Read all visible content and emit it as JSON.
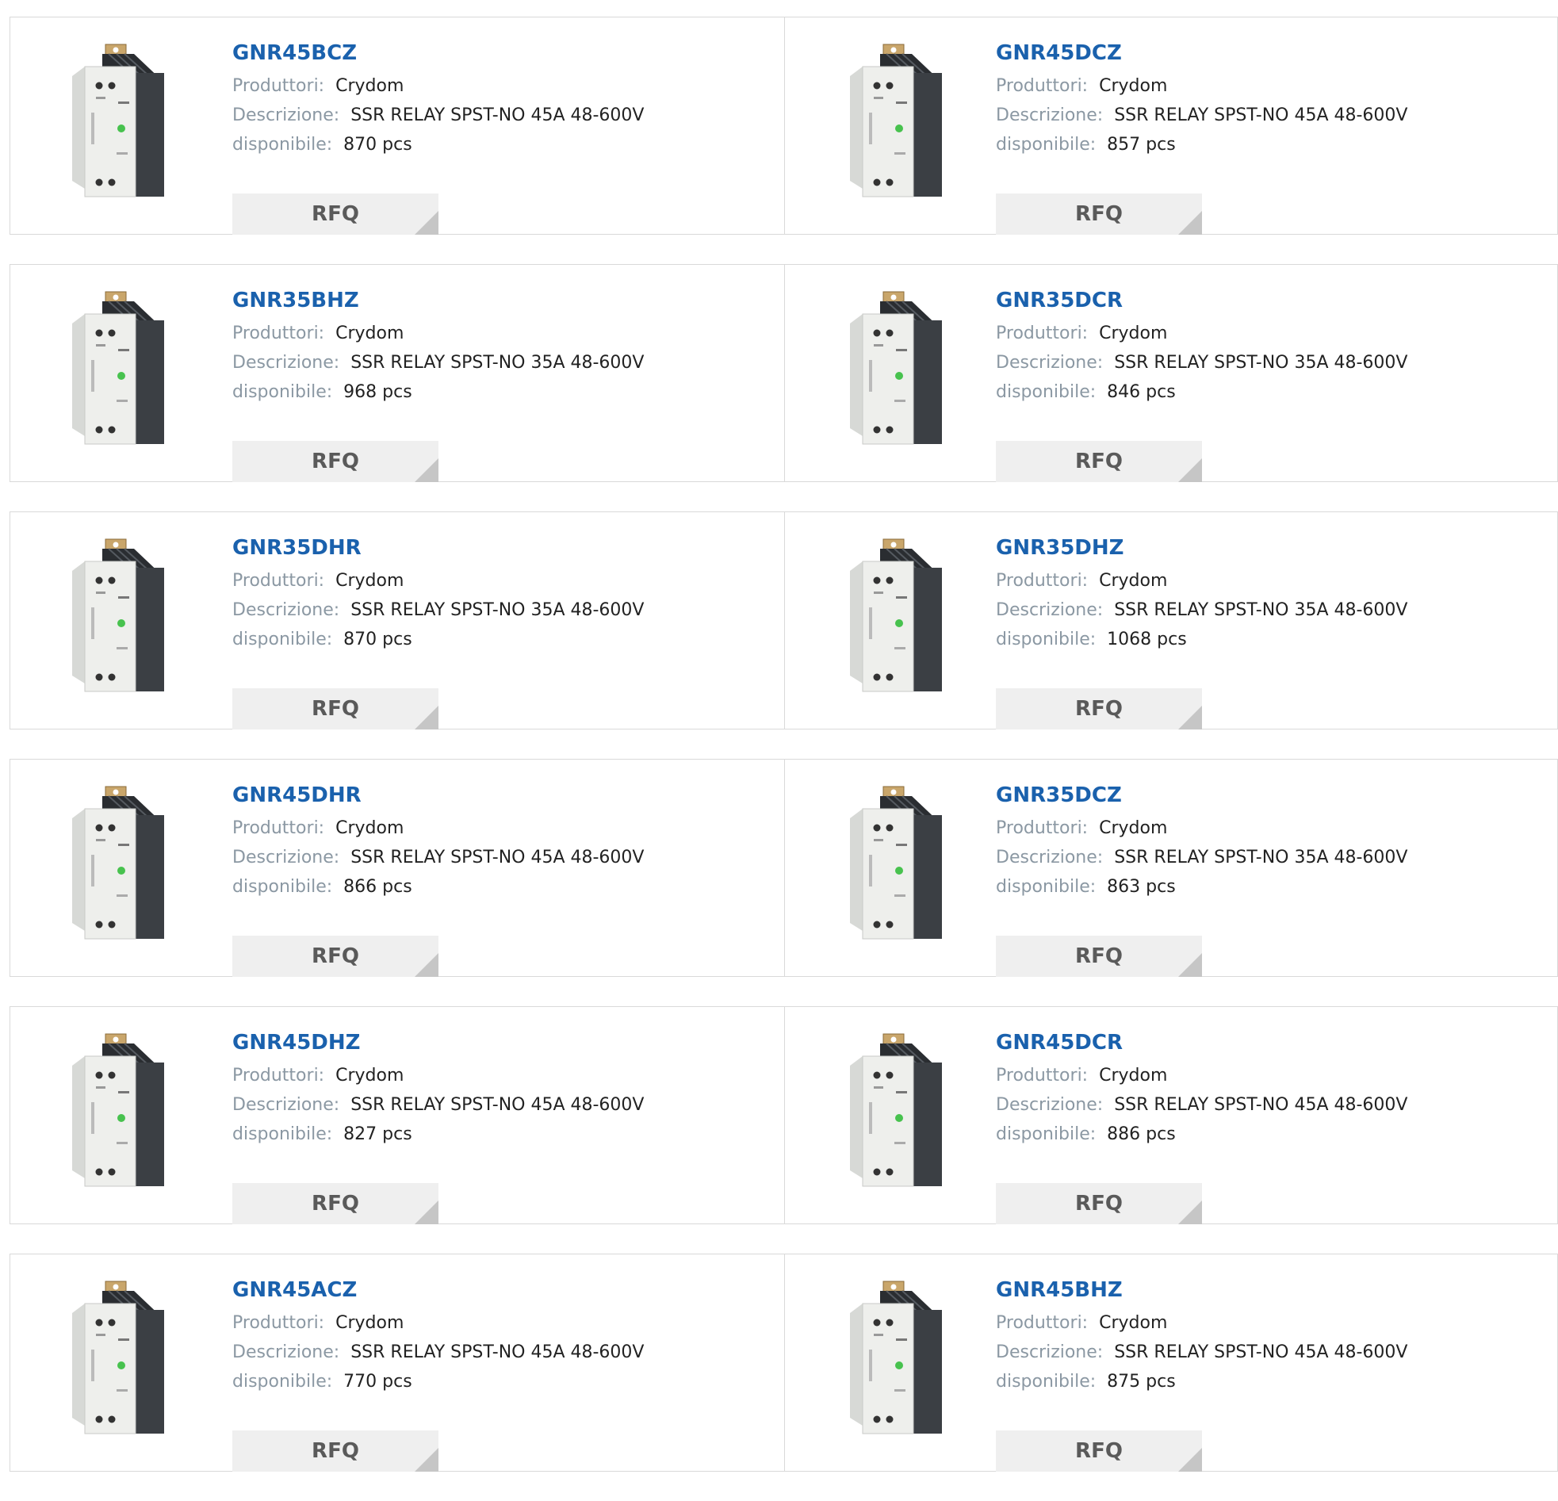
{
  "labels": {
    "manufacturer": "Produttori:",
    "description": "Descrizione:",
    "available": "disponibile:",
    "rfq": "RFQ"
  },
  "products": [
    {
      "part": "GNR45BCZ",
      "manufacturer": "Crydom",
      "description": "SSR RELAY SPST-NO 45A 48-600V",
      "available": "870 pcs"
    },
    {
      "part": "GNR45DCZ",
      "manufacturer": "Crydom",
      "description": "SSR RELAY SPST-NO 45A 48-600V",
      "available": "857 pcs"
    },
    {
      "part": "GNR35BHZ",
      "manufacturer": "Crydom",
      "description": "SSR RELAY SPST-NO 35A 48-600V",
      "available": "968 pcs"
    },
    {
      "part": "GNR35DCR",
      "manufacturer": "Crydom",
      "description": "SSR RELAY SPST-NO 35A 48-600V",
      "available": "846 pcs"
    },
    {
      "part": "GNR35DHR",
      "manufacturer": "Crydom",
      "description": "SSR RELAY SPST-NO 35A 48-600V",
      "available": "870 pcs"
    },
    {
      "part": "GNR35DHZ",
      "manufacturer": "Crydom",
      "description": "SSR RELAY SPST-NO 35A 48-600V",
      "available": "1068 pcs"
    },
    {
      "part": "GNR45DHR",
      "manufacturer": "Crydom",
      "description": "SSR RELAY SPST-NO 45A 48-600V",
      "available": "866 pcs"
    },
    {
      "part": "GNR35DCZ",
      "manufacturer": "Crydom",
      "description": "SSR RELAY SPST-NO 35A 48-600V",
      "available": "863 pcs"
    },
    {
      "part": "GNR45DHZ",
      "manufacturer": "Crydom",
      "description": "SSR RELAY SPST-NO 45A 48-600V",
      "available": "827 pcs"
    },
    {
      "part": "GNR45DCR",
      "manufacturer": "Crydom",
      "description": "SSR RELAY SPST-NO 45A 48-600V",
      "available": "886 pcs"
    },
    {
      "part": "GNR45ACZ",
      "manufacturer": "Crydom",
      "description": "SSR RELAY SPST-NO 45A 48-600V",
      "available": "770 pcs"
    },
    {
      "part": "GNR45BHZ",
      "manufacturer": "Crydom",
      "description": "SSR RELAY SPST-NO 45A 48-600V",
      "available": "875 pcs"
    }
  ],
  "colors": {
    "title": "#1a61ad",
    "label": "#8b98a3",
    "value": "#222222",
    "rfq_bg": "#efefef",
    "rfq_text": "#5a5a5a",
    "border": "#d9d9d9"
  },
  "icons": {
    "product_image": "ssr-relay-image"
  }
}
